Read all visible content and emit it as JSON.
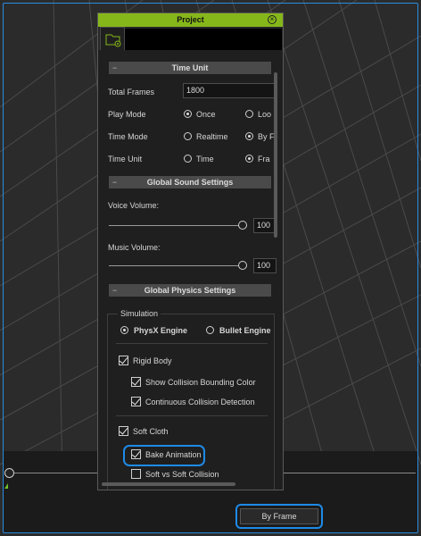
{
  "panel": {
    "title": "Project",
    "tab_icon": "folder-gear-icon"
  },
  "time_unit": {
    "header": "Time Unit",
    "total_frames_label": "Total Frames",
    "total_frames_value": "1800",
    "play_mode_label": "Play Mode",
    "play_mode_options": [
      "Once",
      "Loo"
    ],
    "play_mode_selected": "Once",
    "time_mode_label": "Time Mode",
    "time_mode_options": [
      "Realtime",
      "By F"
    ],
    "time_mode_selected": "By F",
    "time_unit_label": "Time Unit",
    "time_unit_options": [
      "Time",
      "Fra"
    ],
    "time_unit_selected": "Fra"
  },
  "sound": {
    "header": "Global Sound Settings",
    "voice_label": "Voice Volume:",
    "voice_value": "100",
    "music_label": "Music Volume:",
    "music_value": "100"
  },
  "physics": {
    "header": "Global Physics Settings",
    "simulation_label": "Simulation",
    "engines": [
      "PhysX Engine",
      "Bullet Engine"
    ],
    "engine_selected": "PhysX Engine",
    "rigid_body": "Rigid Body",
    "show_bounding": "Show Collision Bounding Color",
    "continuous_collision": "Continuous Collision Detection",
    "soft_cloth": "Soft Cloth",
    "bake_animation": "Bake Animation",
    "soft_vs_soft": "Soft vs Soft Collision"
  },
  "footer": {
    "by_frame_label": "By Frame"
  },
  "colors": {
    "title_bar": "#86b71a",
    "highlight": "#1e8ae6"
  }
}
